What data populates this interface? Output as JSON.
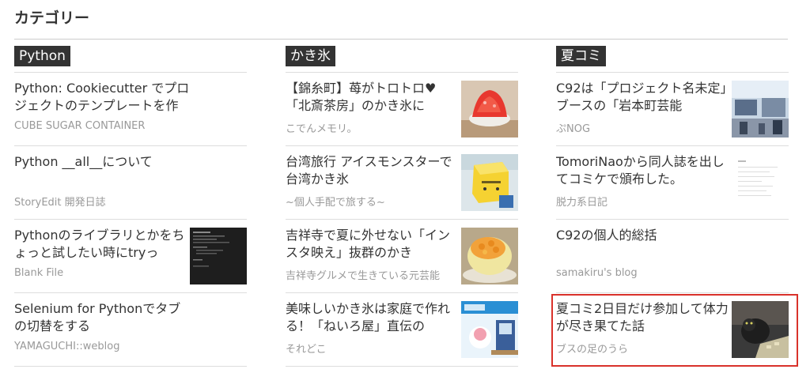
{
  "heading": "カテゴリー",
  "columns": [
    {
      "category": "Python",
      "entries": [
        {
          "title": "Python: Cookiecutter でプロジェクトのテンプレートを作る",
          "site": "CUBE SUGAR CONTAINER"
        },
        {
          "title": "Python __all__について",
          "site": "StoryEdit 開発日誌"
        },
        {
          "title": "Pythonのライブラリとかをちょっと試したい時にtryっ",
          "site": "Blank File"
        },
        {
          "title": "Selenium for Pythonでタブの切替をする",
          "site": "YAMAGUCHI::weblog"
        }
      ]
    },
    {
      "category": "かき氷",
      "entries": [
        {
          "title": "【錦糸町】苺がトロトロ♥「北斎茶房」のかき氷に",
          "site": "こでんメモリ。"
        },
        {
          "title": "台湾旅行 アイスモンスターで台湾かき氷",
          "site": "~個人手配で旅する~"
        },
        {
          "title": "吉祥寺で夏に外せない「インスタ映え」抜群のかき",
          "site": "吉祥寺グルメで生きている元芸能"
        },
        {
          "title": "美味しいかき氷は家庭で作れる！「ねいろ屋」直伝の",
          "site": "それどこ"
        }
      ]
    },
    {
      "category": "夏コミ",
      "entries": [
        {
          "title": "C92は「プロジェクト名未定」ブースの「岩本町芸能",
          "site": "ぷNOG"
        },
        {
          "title": "TomoriNaoから同人誌を出してコミケで頒布した。",
          "site": "脱力系日記"
        },
        {
          "title": "C92の個人的総括",
          "site": "samakiru's blog"
        },
        {
          "title": "夏コミ2日目だけ参加して体力が尽き果てた話",
          "site": "ブスの足のうら"
        }
      ]
    }
  ],
  "colors": {
    "accent": "#333333",
    "highlight": "#d9322b",
    "meta": "#999999"
  }
}
